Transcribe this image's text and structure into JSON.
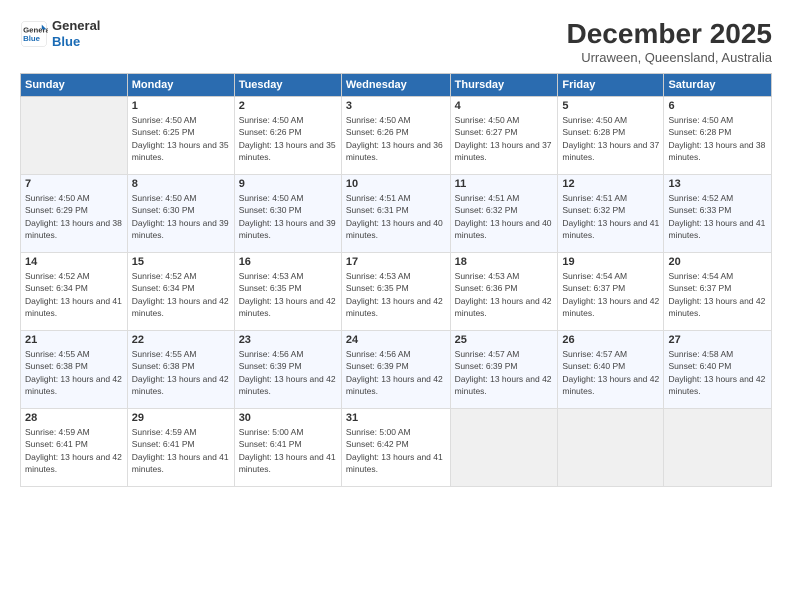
{
  "header": {
    "logo_line1": "General",
    "logo_line2": "Blue",
    "month": "December 2025",
    "location": "Urraween, Queensland, Australia"
  },
  "days_of_week": [
    "Sunday",
    "Monday",
    "Tuesday",
    "Wednesday",
    "Thursday",
    "Friday",
    "Saturday"
  ],
  "weeks": [
    [
      {
        "day": "",
        "empty": true
      },
      {
        "day": "1",
        "rise": "4:50 AM",
        "set": "6:25 PM",
        "daylight": "13 hours and 35 minutes."
      },
      {
        "day": "2",
        "rise": "4:50 AM",
        "set": "6:26 PM",
        "daylight": "13 hours and 35 minutes."
      },
      {
        "day": "3",
        "rise": "4:50 AM",
        "set": "6:26 PM",
        "daylight": "13 hours and 36 minutes."
      },
      {
        "day": "4",
        "rise": "4:50 AM",
        "set": "6:27 PM",
        "daylight": "13 hours and 37 minutes."
      },
      {
        "day": "5",
        "rise": "4:50 AM",
        "set": "6:28 PM",
        "daylight": "13 hours and 37 minutes."
      },
      {
        "day": "6",
        "rise": "4:50 AM",
        "set": "6:28 PM",
        "daylight": "13 hours and 38 minutes."
      }
    ],
    [
      {
        "day": "7",
        "rise": "4:50 AM",
        "set": "6:29 PM",
        "daylight": "13 hours and 38 minutes."
      },
      {
        "day": "8",
        "rise": "4:50 AM",
        "set": "6:30 PM",
        "daylight": "13 hours and 39 minutes."
      },
      {
        "day": "9",
        "rise": "4:50 AM",
        "set": "6:30 PM",
        "daylight": "13 hours and 39 minutes."
      },
      {
        "day": "10",
        "rise": "4:51 AM",
        "set": "6:31 PM",
        "daylight": "13 hours and 40 minutes."
      },
      {
        "day": "11",
        "rise": "4:51 AM",
        "set": "6:32 PM",
        "daylight": "13 hours and 40 minutes."
      },
      {
        "day": "12",
        "rise": "4:51 AM",
        "set": "6:32 PM",
        "daylight": "13 hours and 41 minutes."
      },
      {
        "day": "13",
        "rise": "4:52 AM",
        "set": "6:33 PM",
        "daylight": "13 hours and 41 minutes."
      }
    ],
    [
      {
        "day": "14",
        "rise": "4:52 AM",
        "set": "6:34 PM",
        "daylight": "13 hours and 41 minutes."
      },
      {
        "day": "15",
        "rise": "4:52 AM",
        "set": "6:34 PM",
        "daylight": "13 hours and 42 minutes."
      },
      {
        "day": "16",
        "rise": "4:53 AM",
        "set": "6:35 PM",
        "daylight": "13 hours and 42 minutes."
      },
      {
        "day": "17",
        "rise": "4:53 AM",
        "set": "6:35 PM",
        "daylight": "13 hours and 42 minutes."
      },
      {
        "day": "18",
        "rise": "4:53 AM",
        "set": "6:36 PM",
        "daylight": "13 hours and 42 minutes."
      },
      {
        "day": "19",
        "rise": "4:54 AM",
        "set": "6:37 PM",
        "daylight": "13 hours and 42 minutes."
      },
      {
        "day": "20",
        "rise": "4:54 AM",
        "set": "6:37 PM",
        "daylight": "13 hours and 42 minutes."
      }
    ],
    [
      {
        "day": "21",
        "rise": "4:55 AM",
        "set": "6:38 PM",
        "daylight": "13 hours and 42 minutes."
      },
      {
        "day": "22",
        "rise": "4:55 AM",
        "set": "6:38 PM",
        "daylight": "13 hours and 42 minutes."
      },
      {
        "day": "23",
        "rise": "4:56 AM",
        "set": "6:39 PM",
        "daylight": "13 hours and 42 minutes."
      },
      {
        "day": "24",
        "rise": "4:56 AM",
        "set": "6:39 PM",
        "daylight": "13 hours and 42 minutes."
      },
      {
        "day": "25",
        "rise": "4:57 AM",
        "set": "6:39 PM",
        "daylight": "13 hours and 42 minutes."
      },
      {
        "day": "26",
        "rise": "4:57 AM",
        "set": "6:40 PM",
        "daylight": "13 hours and 42 minutes."
      },
      {
        "day": "27",
        "rise": "4:58 AM",
        "set": "6:40 PM",
        "daylight": "13 hours and 42 minutes."
      }
    ],
    [
      {
        "day": "28",
        "rise": "4:59 AM",
        "set": "6:41 PM",
        "daylight": "13 hours and 42 minutes."
      },
      {
        "day": "29",
        "rise": "4:59 AM",
        "set": "6:41 PM",
        "daylight": "13 hours and 41 minutes."
      },
      {
        "day": "30",
        "rise": "5:00 AM",
        "set": "6:41 PM",
        "daylight": "13 hours and 41 minutes."
      },
      {
        "day": "31",
        "rise": "5:00 AM",
        "set": "6:42 PM",
        "daylight": "13 hours and 41 minutes."
      },
      {
        "day": "",
        "empty": true
      },
      {
        "day": "",
        "empty": true
      },
      {
        "day": "",
        "empty": true
      }
    ]
  ],
  "labels": {
    "sunrise_prefix": "Sunrise: ",
    "sunset_prefix": "Sunset: ",
    "daylight_prefix": "Daylight: "
  }
}
